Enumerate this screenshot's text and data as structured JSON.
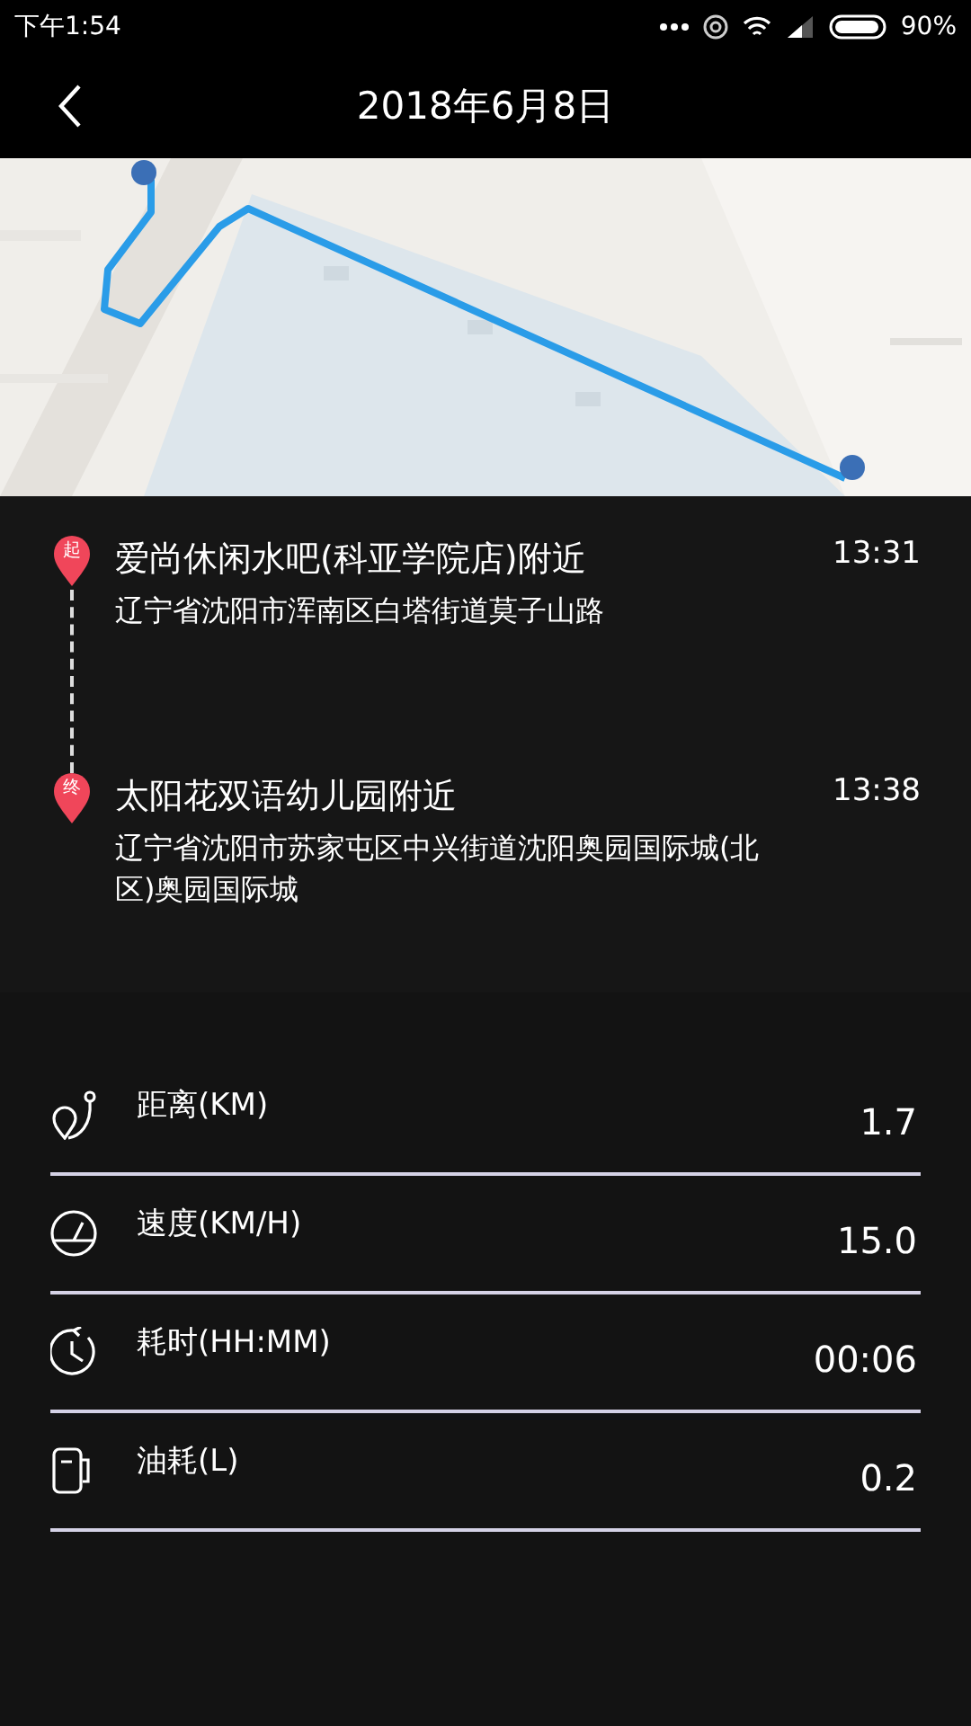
{
  "status_bar": {
    "time": "下午1:54",
    "battery": "90%"
  },
  "header": {
    "title": "2018年6月8日"
  },
  "route": [
    {
      "marker": "起",
      "place": "爱尚休闲水吧(科亚学院店)附近",
      "address": "辽宁省沈阳市浑南区白塔街道莫子山路",
      "time": "13:31"
    },
    {
      "marker": "终",
      "place": "太阳花双语幼儿园附近",
      "address": "辽宁省沈阳市苏家屯区中兴街道沈阳奥园国际城(北区)奥园国际城",
      "time": "13:38"
    }
  ],
  "stats": [
    {
      "kind": "distance",
      "label": "距离(KM)",
      "value": "1.7"
    },
    {
      "kind": "speed",
      "label": "速度(KM/H)",
      "value": "15.0"
    },
    {
      "kind": "time",
      "label": "耗时(HH:MM)",
      "value": "00:06"
    },
    {
      "kind": "fuel",
      "label": "油耗(L)",
      "value": "0.2"
    }
  ]
}
